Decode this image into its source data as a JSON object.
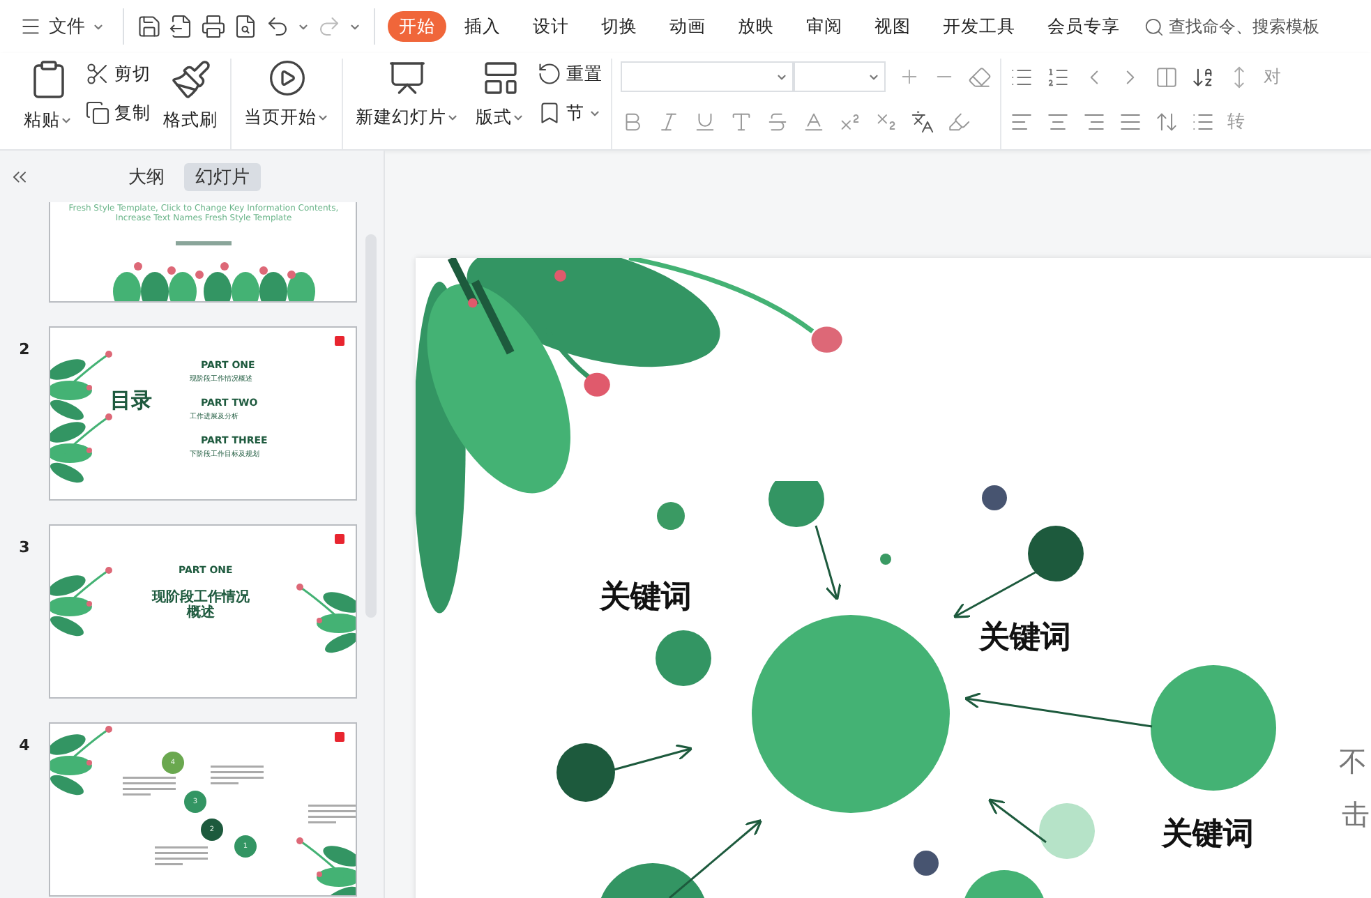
{
  "file_menu": {
    "label": "文件"
  },
  "tabs": [
    {
      "label": "开始",
      "selected": true
    },
    {
      "label": "插入",
      "selected": false
    },
    {
      "label": "设计",
      "selected": false
    },
    {
      "label": "切换",
      "selected": false
    },
    {
      "label": "动画",
      "selected": false
    },
    {
      "label": "放映",
      "selected": false
    },
    {
      "label": "审阅",
      "selected": false
    },
    {
      "label": "视图",
      "selected": false
    },
    {
      "label": "开发工具",
      "selected": false
    },
    {
      "label": "会员专享",
      "selected": false
    }
  ],
  "search": {
    "placeholder": "查找命令、搜索模板"
  },
  "ribbon": {
    "paste": "粘贴",
    "cut": "剪切",
    "copy": "复制",
    "format_painter": "格式刷",
    "play_from_current": "当页开始",
    "new_slide": "新建幻灯片",
    "layout": "版式",
    "reset": "重置",
    "section": "节",
    "cut_off_labels": [
      "对",
      "转"
    ]
  },
  "panel_tabs": [
    {
      "label": "大纲",
      "selected": false
    },
    {
      "label": "幻灯片",
      "selected": true
    }
  ],
  "thumbnails": [
    {
      "kind": "title",
      "tagline": "Fresh Style Template, Click to Change Key Information Contents, Increase Text Names Fresh Style Template"
    },
    {
      "kind": "contents",
      "number": "2",
      "heading": "目录",
      "items": [
        {
          "title": "PART ONE",
          "subtitle": "现阶段工作情况概述"
        },
        {
          "title": "PART TWO",
          "subtitle": "工作进展及分析"
        },
        {
          "title": "PART THREE",
          "subtitle": "下阶段工作目标及规划"
        }
      ]
    },
    {
      "kind": "section",
      "number": "3",
      "title": "PART ONE",
      "heading": "现阶段工作情况概述"
    },
    {
      "kind": "timeline",
      "number": "4",
      "steps": [
        "4",
        "3",
        "2",
        "1"
      ]
    }
  ],
  "slide": {
    "keywords": [
      "关键词",
      "关键词",
      "关键词"
    ],
    "edge_text": [
      "不",
      "击"
    ]
  }
}
